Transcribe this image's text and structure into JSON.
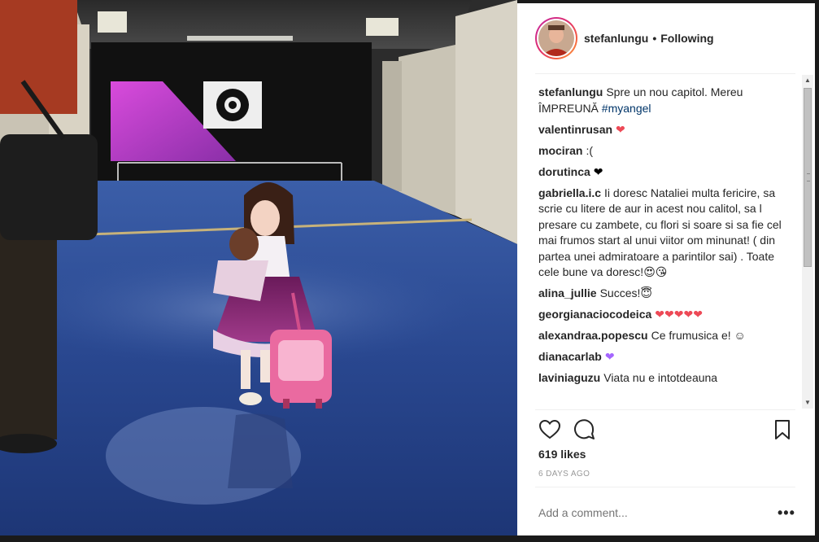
{
  "post": {
    "username": "stefanlungu",
    "separator": "•",
    "follow_status": "Following",
    "likes": "619 likes",
    "date": "6 DAYS AGO",
    "add_comment_placeholder": "Add a comment...",
    "more_label": "•••"
  },
  "caption": {
    "user": "stefanlungu",
    "text": "Spre un nou capitol. Mereu ÎMPREUNĂ",
    "hashtag": "#myangel"
  },
  "comments": [
    {
      "user": "valentinrusan",
      "text": "",
      "emoji": "❤",
      "emoji_color": "pink"
    },
    {
      "user": "mociran",
      "text": ":(",
      "emoji": "",
      "emoji_color": ""
    },
    {
      "user": "dorutinca",
      "text": "",
      "emoji": "❤",
      "emoji_color": "black"
    },
    {
      "user": "gabriella.i.c",
      "text": "Ii doresc Nataliei multa fericire, sa scrie cu litere de aur in acest nou calitol, sa l presare cu zambete, cu flori si soare si sa fie cel mai frumos start al unui viitor om minunat! ( din partea unei admiratoare a parintilor sai) . Toate cele bune va doresc!😍😘",
      "emoji": "",
      "emoji_color": ""
    },
    {
      "user": "alina_jullie",
      "text": "Succes!😇",
      "emoji": "",
      "emoji_color": ""
    },
    {
      "user": "georgianaciocodeica",
      "text": "",
      "emoji": "❤❤❤❤❤",
      "emoji_color": "pink"
    },
    {
      "user": "alexandraa.popescu",
      "text": "Ce frumusica e! ☺",
      "emoji": "",
      "emoji_color": ""
    },
    {
      "user": "dianacarlab",
      "text": "",
      "emoji": "❤",
      "emoji_color": "purple"
    },
    {
      "user": "laviniaguzu",
      "text": "Viata nu e intotdeauna",
      "emoji": "",
      "emoji_color": ""
    }
  ],
  "icons": {
    "like": "heart-outline-icon",
    "comment": "speech-bubble-icon",
    "save": "bookmark-icon",
    "scroll_up": "scroll-up-arrow-icon",
    "scroll_down": "scroll-down-arrow-icon"
  },
  "colors": {
    "heart_pink": "#ed4956",
    "heart_purple": "#a566ff",
    "hashtag": "#003569",
    "avatar_ring": "#e1306c"
  }
}
